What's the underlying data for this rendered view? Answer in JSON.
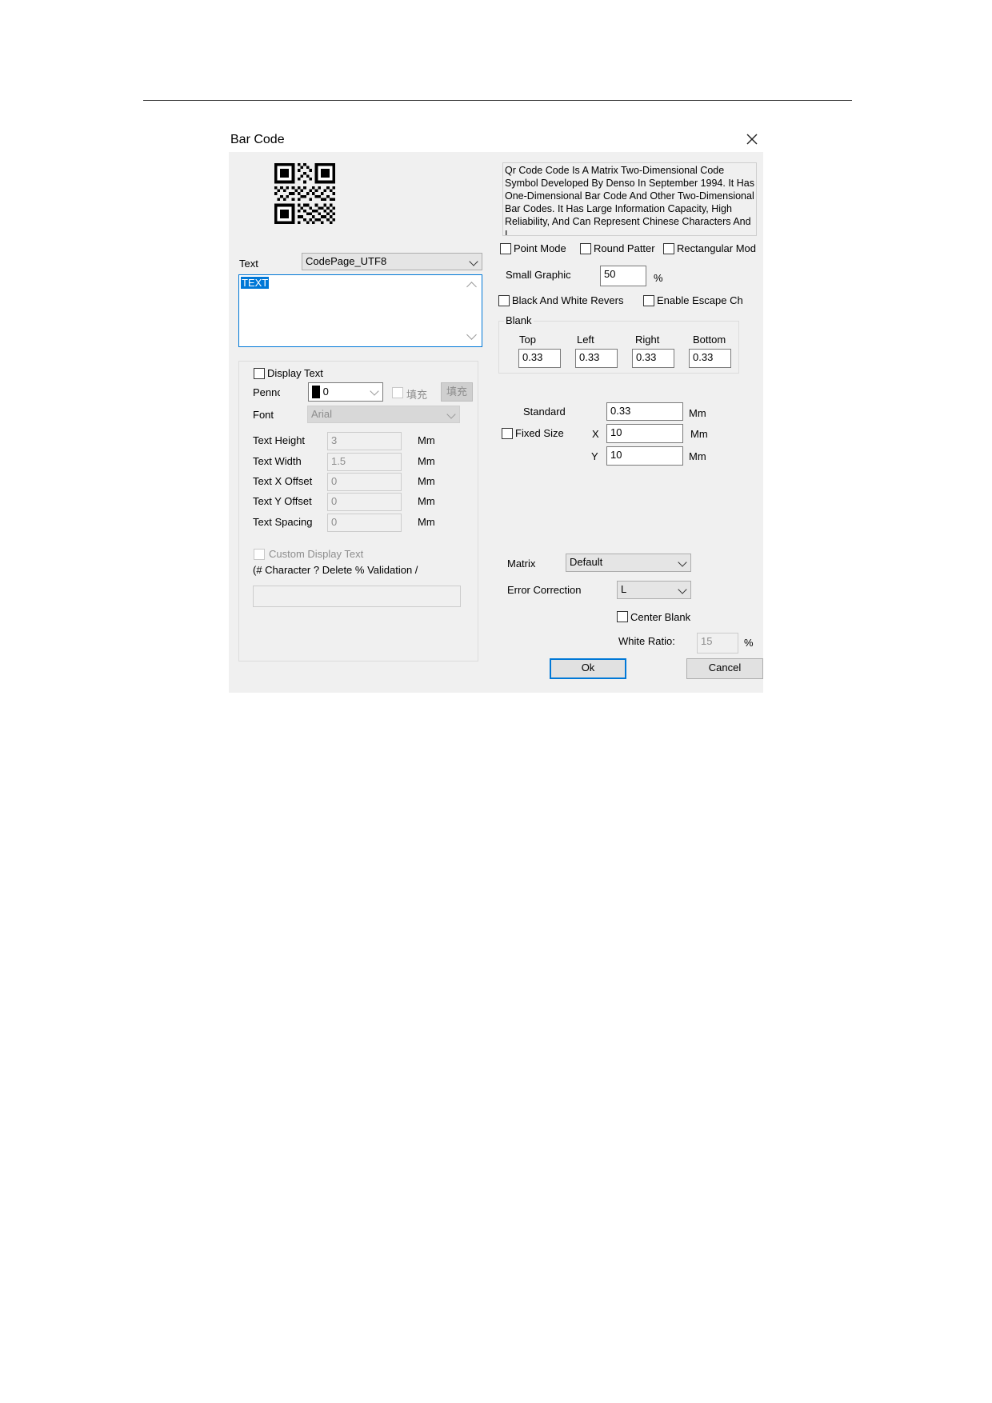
{
  "dialog": {
    "title": "Bar Code",
    "description": "Qr Code Code Is A Matrix Two-Dimensional Code Symbol Developed By Denso In September 1994. It Has One-Dimensional Bar Code And Other Two-Dimensional Bar Codes. It Has Large Information Capacity, High Reliability, And Can Represent Chinese Characters And I"
  },
  "text_section": {
    "label": "Text",
    "codepage_value": "CodePage_UTF8",
    "content": "TEXT"
  },
  "display_text": {
    "checkbox_label": "Display Text",
    "pen_label": "Penno",
    "pen_value": "0",
    "fill_checkbox_label": "填充",
    "fill_button_label": "填充",
    "font_label": "Font",
    "font_value": "Arial",
    "rows": [
      {
        "label": "Text Height",
        "value": "3",
        "unit": "Mm"
      },
      {
        "label": "Text Width",
        "value": "1.5",
        "unit": "Mm"
      },
      {
        "label": "Text X Offset",
        "value": "0",
        "unit": "Mm"
      },
      {
        "label": "Text Y Offset",
        "value": "0",
        "unit": "Mm"
      },
      {
        "label": "Text Spacing",
        "value": "0",
        "unit": "Mm"
      }
    ],
    "custom_label": "Custom Display Text",
    "custom_hint": "(# Character ? Delete % Validation /",
    "custom_value": ""
  },
  "modes": {
    "point_mode": "Point Mode",
    "round_pattern": "Round Patter",
    "rectangular_mode": "Rectangular Mod"
  },
  "small_graphic": {
    "label": "Small Graphic",
    "value": "50",
    "unit": "%"
  },
  "options": {
    "bw_reverse": "Black And White Revers",
    "escape": "Enable Escape Ch"
  },
  "blank": {
    "label": "Blank",
    "top_label": "Top",
    "top_value": "0.33",
    "left_label": "Left",
    "left_value": "0.33",
    "right_label": "Right",
    "right_value": "0.33",
    "bottom_label": "Bottom",
    "bottom_value": "0.33"
  },
  "size": {
    "standard_label": "Standard",
    "standard_value": "0.33",
    "standard_unit": "Mm",
    "fixed_label": "Fixed Size",
    "x_label": "X",
    "x_value": "10",
    "x_unit": "Mm",
    "y_label": "Y",
    "y_value": "10",
    "y_unit": "Mm"
  },
  "matrix": {
    "label": "Matrix",
    "value": "Default"
  },
  "error_correction": {
    "label": "Error Correction",
    "value": "L"
  },
  "center_blank": {
    "label": "Center Blank"
  },
  "white_ratio": {
    "label": "White Ratio:",
    "value": "15",
    "unit": "%"
  },
  "buttons": {
    "ok": "Ok",
    "cancel": "Cancel"
  },
  "icons": {
    "close": "close-icon",
    "qr": "qr-code-icon"
  }
}
